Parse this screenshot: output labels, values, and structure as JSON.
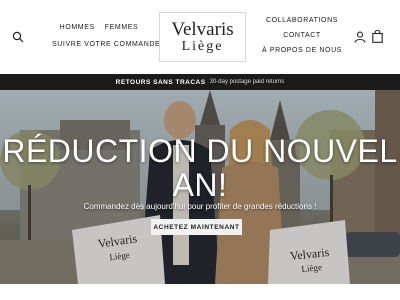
{
  "header": {
    "nav_left": [
      "HOMMES",
      "FEMMES",
      "SUIVRE VOTRE COMMANDE"
    ],
    "logo": {
      "line1": "Velvaris",
      "line2": "Liège"
    },
    "nav_right": [
      "COLLABORATIONS",
      "CONTACT",
      "À PROPOS DE NOUS"
    ],
    "icons": [
      "search-icon",
      "user-icon",
      "bag-icon"
    ]
  },
  "announcement": {
    "strong": "RETOURS SANS TRACAS",
    "light": "30-day postage paid returns"
  },
  "hero": {
    "title_line1": "RÉDUCTION DU NOUVEL",
    "title_line2": "AN!",
    "subtitle": "Commandez dès aujourd'hui pour profiter de grandes réductions !",
    "button": "ACHETEZ MAINTENANT",
    "bag_left": {
      "line1": "Velvaris",
      "line2": "Liège"
    },
    "bag_right": {
      "line1": "Velvaris",
      "line2": "Liège"
    }
  },
  "colors": {
    "announcement_bg": "#1b1b1b",
    "button_bg": "#f2f2f2",
    "text": "#1a1a1a"
  }
}
